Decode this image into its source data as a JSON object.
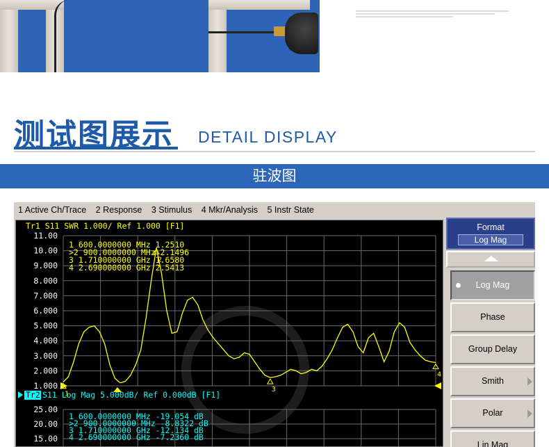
{
  "page": {
    "heading_cn": "测试图展示",
    "heading_en": "DETAIL DISPLAY",
    "banner_label": "驻波图",
    "colors": {
      "accent": "#1d5aa8",
      "banner": "#2b66b8",
      "trace": "#ffff00",
      "trace2_text": "#00ffff"
    }
  },
  "vna": {
    "menu": [
      "1 Active Ch/Trace",
      "2 Response",
      "3 Stimulus",
      "4 Mkr/Analysis",
      "5 Instr State"
    ],
    "tr1_header": "Tr1  S11  SWR 1.000/ Ref 1.000 [F1]",
    "tr2_tag": "Tr2",
    "tr2_header": " S11  Log Mag 5.000dB/ Ref 0.000dB [F1]",
    "softkeys": {
      "title": "Format",
      "current": "Log Mag",
      "items": [
        {
          "label": "Log Mag",
          "active": true,
          "arrow": false
        },
        {
          "label": "Phase",
          "active": false,
          "arrow": false
        },
        {
          "label": "Group Delay",
          "active": false,
          "arrow": false
        },
        {
          "label": "Smith",
          "active": false,
          "arrow": true
        },
        {
          "label": "Polar",
          "active": false,
          "arrow": true
        },
        {
          "label": "Lin Mag",
          "active": false,
          "arrow": false
        }
      ]
    }
  },
  "chart_data": [
    {
      "type": "line",
      "title": "Tr1 S11 SWR 1.000/ Ref 1.000 [F1]",
      "ylim": [
        1,
        11
      ],
      "yticks": [
        "11.00",
        "10.00",
        "9.000",
        "8.000",
        "7.000",
        "6.000",
        "5.000",
        "4.000",
        "3.000",
        "2.000",
        "1.000"
      ],
      "markers": [
        {
          "id": "1",
          "freq": "600.0000000 MHz",
          "value": "1.2510"
        },
        {
          "id": ">2",
          "freq": "900.0000000 MHz",
          "value": "2.1496"
        },
        {
          "id": "3",
          "freq": "1.710000000 GHz",
          "value": "1.6580"
        },
        {
          "id": "4",
          "freq": "2.690000000 GHz",
          "value": "2.5413"
        }
      ],
      "series": [
        {
          "values": [
            1.25,
            1.6,
            2.6,
            3.8,
            4.6,
            4.9,
            5.0,
            4.6,
            3.8,
            2.4,
            1.5,
            1.2,
            1.3,
            1.7,
            2.4,
            3.4,
            5.5,
            8.0,
            10.2,
            8.5,
            6.0,
            4.5,
            4.6,
            5.8,
            6.7,
            6.9,
            6.4,
            5.4,
            4.7,
            4.2,
            3.8,
            3.4,
            3.0,
            2.8,
            2.9,
            3.2,
            3.1,
            2.6,
            2.1,
            1.7,
            1.55,
            1.6,
            1.7,
            1.9,
            2.1,
            2.0,
            1.8,
            1.9,
            2.1,
            2.0,
            2.3,
            2.8,
            3.4,
            4.2,
            4.9,
            5.1,
            4.6,
            3.6,
            3.2,
            4.2,
            4.5,
            3.6,
            2.6,
            3.3,
            4.6,
            5.2,
            4.9,
            3.9,
            3.4,
            3.0,
            2.7,
            2.6,
            2.55
          ]
        }
      ]
    },
    {
      "type": "table",
      "title": "Tr2 S11 Log Mag 5.000dB/ Ref 0.000dB [F1]",
      "yticks": [
        "25.00",
        "20.00",
        "15.00"
      ],
      "markers": [
        {
          "id": "1",
          "freq": "600.0000000 MHz",
          "value": "-19.054 dB"
        },
        {
          "id": ">2",
          "freq": "900.0000000 MHz",
          "value": "-8.8322 dB"
        },
        {
          "id": "3",
          "freq": "1.710000000 GHz",
          "value": "-12.134 dB"
        },
        {
          "id": "4",
          "freq": "2.690000000 GHz",
          "value": "-7.2360 dB"
        }
      ]
    }
  ]
}
